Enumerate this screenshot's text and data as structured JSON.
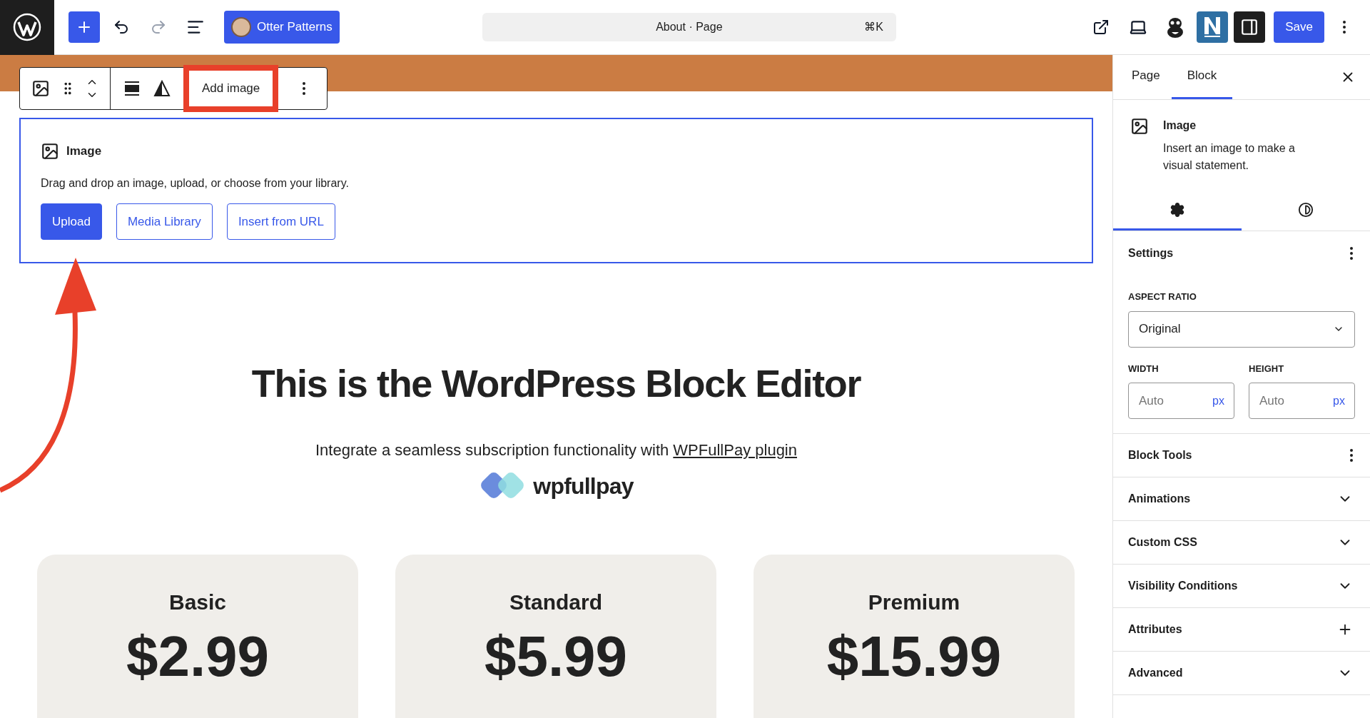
{
  "top_bar": {
    "tools": [
      {
        "kind": "inserter",
        "disabled": false
      },
      {
        "kind": "undo",
        "disabled": false
      },
      {
        "kind": "redo",
        "disabled": true
      },
      {
        "kind": "list",
        "disabled": false
      }
    ],
    "patterns_button": "Otter Patterns",
    "command": {
      "title": "About · Page",
      "shortcut": "⌘K"
    },
    "actions": [
      {
        "kind": "view",
        "pressed": false
      },
      {
        "kind": "preview",
        "pressed": false
      },
      {
        "kind": "otter",
        "pressed": false
      },
      {
        "kind": "n-logo",
        "pressed": false
      },
      {
        "kind": "sidebar",
        "pressed": true
      }
    ],
    "save": "Save"
  },
  "block_toolbar": {
    "action": {
      "label": "Add image",
      "highlighted": true
    }
  },
  "image_block": {
    "title": "Image",
    "instructions": "Drag and drop an image, upload, or choose from your library.",
    "buttons": [
      {
        "label": "Upload",
        "kind": "primary"
      },
      {
        "label": "Media Library",
        "kind": "secondary"
      },
      {
        "label": "Insert from URL",
        "kind": "secondary"
      }
    ]
  },
  "content": {
    "heading": "This is the WordPress Block Editor",
    "subtitle": "Integrate a seamless subscription functionality with ",
    "link": "WPFullPay plugin",
    "logo": "wpfullpay",
    "cards": [
      {
        "name": "Basic",
        "price": "$2.99"
      },
      {
        "name": "Standard",
        "price": "$5.99"
      },
      {
        "name": "Premium",
        "price": "$15.99"
      }
    ]
  },
  "sidebar": {
    "tabs": [
      {
        "label": "Page",
        "selected": false
      },
      {
        "label": "Block",
        "selected": true
      }
    ],
    "block": {
      "title": "Image",
      "description": "Insert an image to make a visual statement."
    },
    "inspector_tabs": [
      {
        "kind": "settings",
        "selected": true
      },
      {
        "kind": "styles",
        "selected": false
      }
    ],
    "settings": {
      "title": "Settings",
      "aspect_label": "ASPECT RATIO",
      "aspect_value": "Original",
      "fields": [
        {
          "label": "WIDTH",
          "placeholder": "Auto",
          "unit": "px"
        },
        {
          "label": "HEIGHT",
          "placeholder": "Auto",
          "unit": "px"
        }
      ]
    },
    "panels": [
      {
        "title": "Block Tools",
        "kind": "menu"
      },
      {
        "title": "Animations",
        "kind": "toggle"
      },
      {
        "title": "Custom CSS",
        "kind": "toggle"
      },
      {
        "title": "Visibility Conditions",
        "kind": "toggle"
      },
      {
        "title": "Attributes",
        "kind": "add"
      },
      {
        "title": "Advanced",
        "kind": "toggle"
      }
    ]
  }
}
